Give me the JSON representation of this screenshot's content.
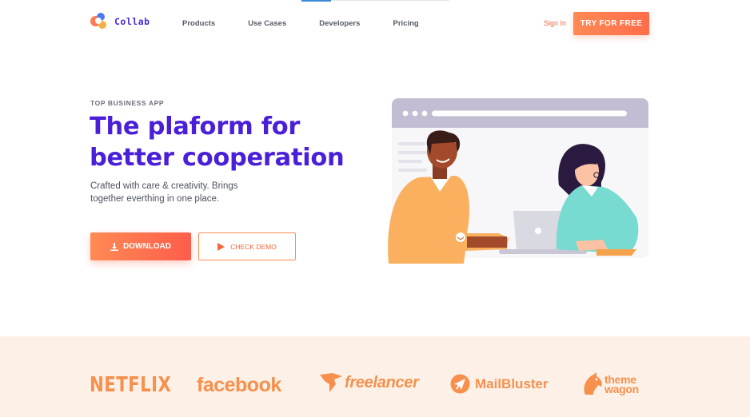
{
  "brand": {
    "name": "Collab"
  },
  "nav": {
    "items": [
      "Products",
      "Use Cases",
      "Developers",
      "Pricing"
    ],
    "sign_in": "Sign In",
    "cta": "TRY FOR FREE"
  },
  "hero": {
    "eyebrow": "TOP BUSINESS APP",
    "title_line1": "The plaform for",
    "title_line2": "better cooperation",
    "subtitle_line1": "Crafted with care & creativity. Brings",
    "subtitle_line2": "together everthing in one place.",
    "download_label": "DOWNLOAD",
    "demo_label": "CHECK DEMO"
  },
  "partners": [
    "NETFLIX",
    "facebook",
    "freelancer",
    "MailBluster",
    "theme",
    "wagon"
  ],
  "colors": {
    "primary": "#4a1fd8",
    "accent": "#ff7a50",
    "partner_bg": "#fdf1e7",
    "partner_logo": "#f7904d"
  }
}
